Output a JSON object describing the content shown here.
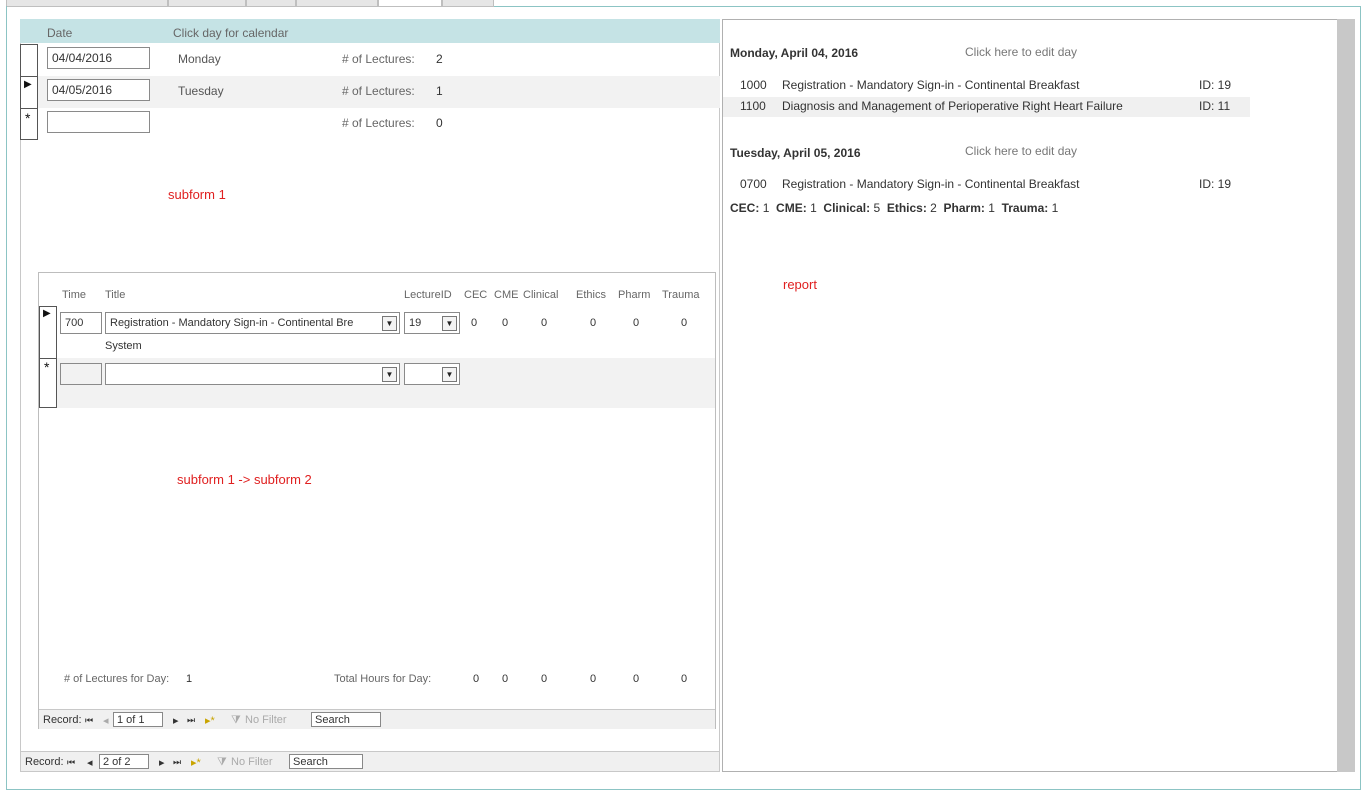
{
  "header": {
    "date_label": "Date",
    "calendar_hint": "Click day for calendar"
  },
  "days": [
    {
      "date": "04/04/2016",
      "weekday": "Monday",
      "lectures_label": "# of Lectures:",
      "lectures": "2"
    },
    {
      "date": "04/05/2016",
      "weekday": "Tuesday",
      "lectures_label": "# of Lectures:",
      "lectures": "1"
    },
    {
      "date": "",
      "weekday": "",
      "lectures_label": "# of Lectures:",
      "lectures": "0"
    }
  ],
  "markers": {
    "current": "▶",
    "new": "*"
  },
  "annotations": {
    "subform1": "subform 1",
    "subform2": "subform 1 -> subform 2",
    "report": "report"
  },
  "subform2": {
    "columns": [
      "Time",
      "Title",
      "LectureID",
      "CEC",
      "CME",
      "Clinical",
      "Ethics",
      "Pharm",
      "Trauma"
    ],
    "row": {
      "time": "700",
      "title": "Registration - Mandatory Sign-in - Continental Bre",
      "lecture_id": "19",
      "values": [
        "0",
        "0",
        "0",
        "0",
        "0",
        "0"
      ],
      "sub": "System"
    },
    "footer": {
      "lectures_label": "# of Lectures for Day:",
      "lectures": "1",
      "hours_label": "Total Hours for Day:",
      "hours": [
        "0",
        "0",
        "0",
        "0",
        "0",
        "0"
      ]
    }
  },
  "recnav_inner": {
    "label": "Record:",
    "first": "⏮",
    "prev": "◂",
    "position": "1 of 1",
    "next": "▸",
    "last": "⏭",
    "new": "▸*",
    "filter": "No Filter",
    "search": "Search"
  },
  "recnav_outer": {
    "label": "Record:",
    "first": "⏮",
    "prev": "◂",
    "position": "2 of 2",
    "next": "▸",
    "last": "⏭",
    "new": "▸*",
    "filter": "No Filter",
    "search": "Search"
  },
  "report": {
    "edit_hint": "Click here to edit day",
    "day1": {
      "heading": "Monday, April 04, 2016",
      "items": [
        {
          "time": "1000",
          "title": "Registration - Mandatory Sign-in - Continental Breakfast",
          "id": "ID: 19"
        },
        {
          "time": "1100",
          "title": "Diagnosis and Management of Perioperative Right Heart Failure",
          "id": "ID: 11"
        }
      ]
    },
    "day2": {
      "heading": "Tuesday, April 05, 2016",
      "items": [
        {
          "time": "0700",
          "title": "Registration - Mandatory Sign-in - Continental Breakfast",
          "id": "ID: 19"
        }
      ]
    },
    "totals": [
      {
        "label": "CEC:",
        "value": "1"
      },
      {
        "label": "CME:",
        "value": "1"
      },
      {
        "label": "Clinical:",
        "value": "5"
      },
      {
        "label": "Ethics:",
        "value": "2"
      },
      {
        "label": "Pharm:",
        "value": "1"
      },
      {
        "label": "Trauma:",
        "value": "1"
      }
    ]
  }
}
